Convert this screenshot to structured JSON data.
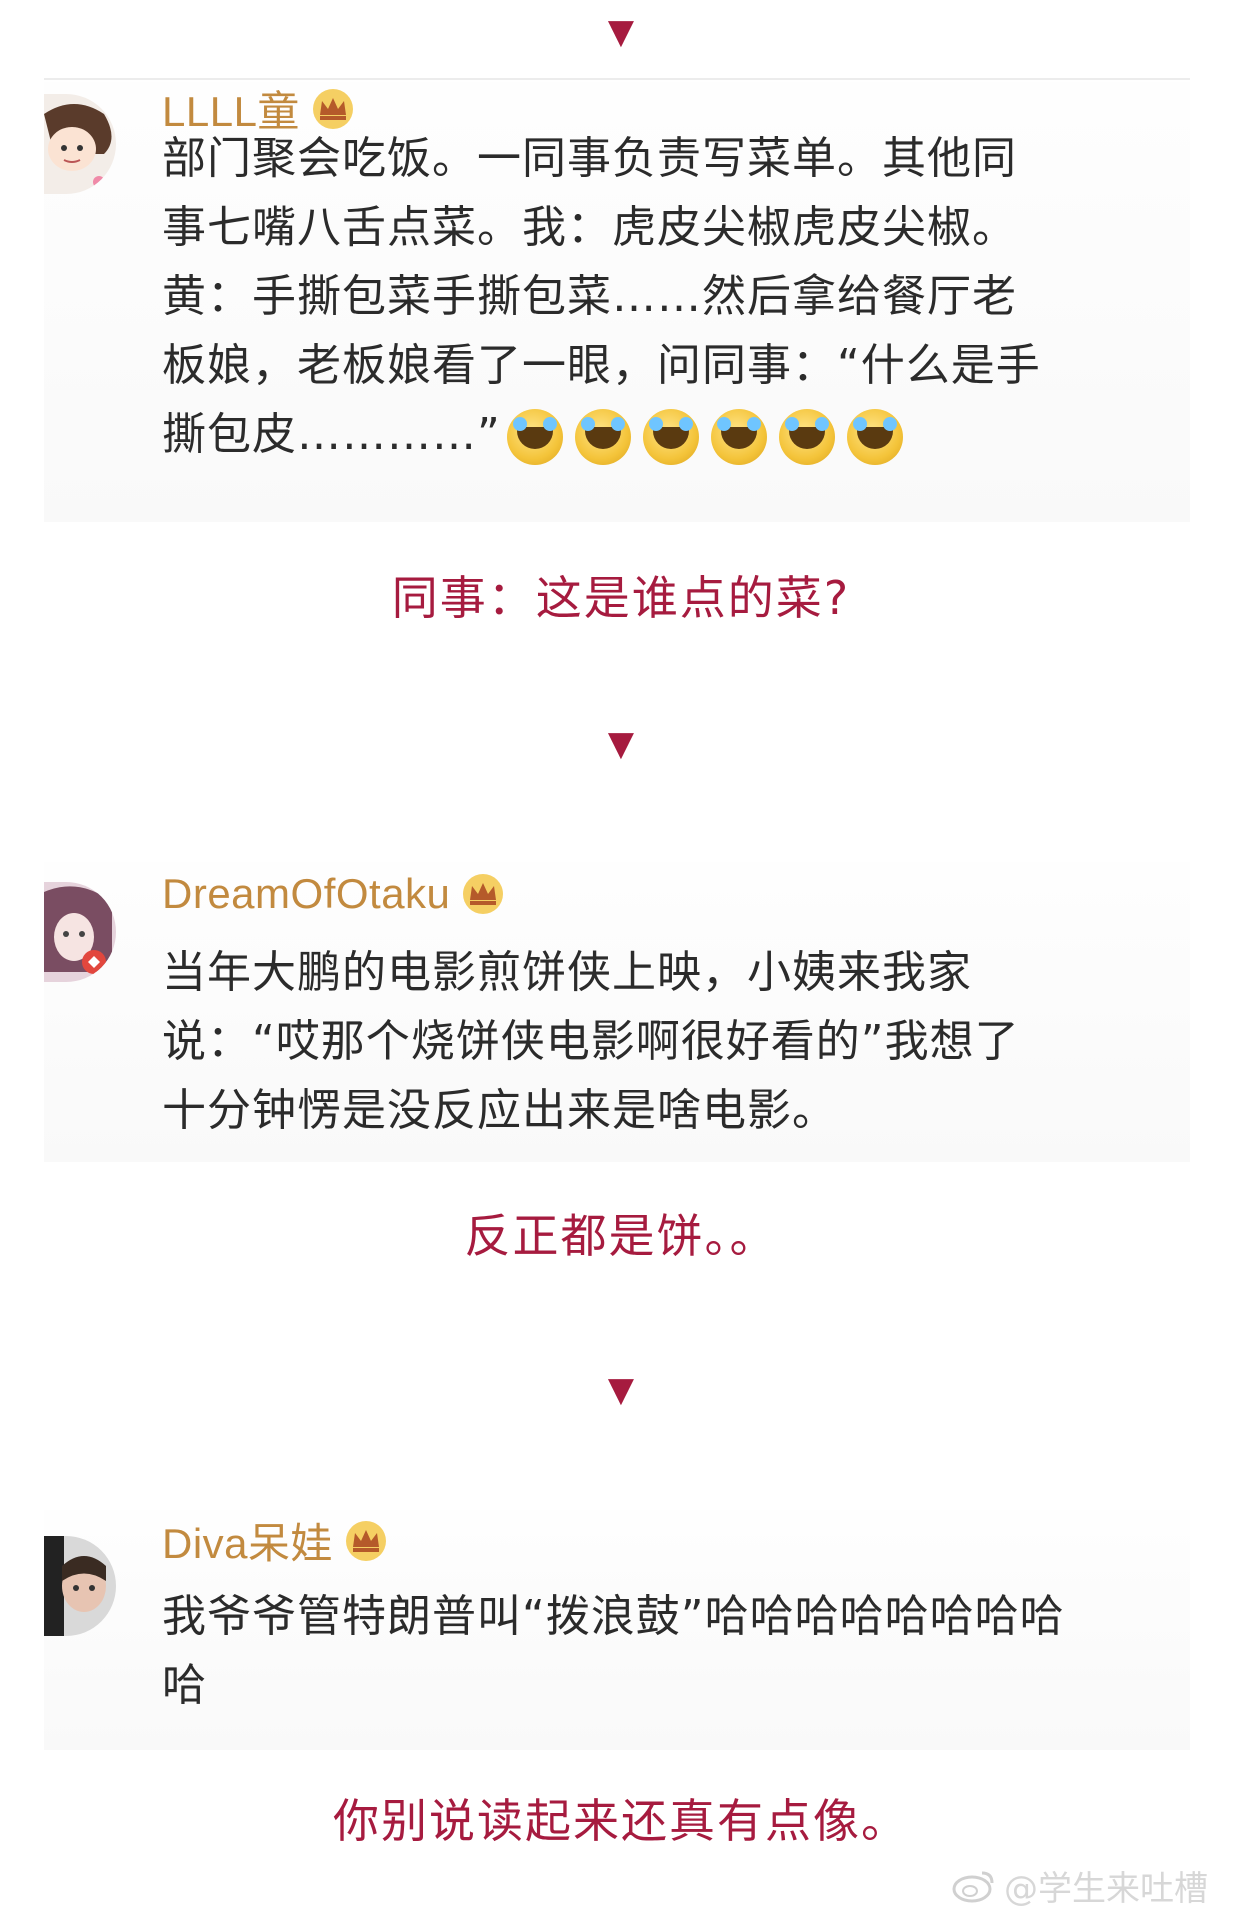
{
  "marker_glyph": "▼",
  "posts": [
    {
      "username": "LLLL童",
      "text": "部门聚会吃饭。一同事负责写菜单。其他同\n事七嘴八舌点菜。我：虎皮尖椒虎皮尖椒。\n黄：手撕包菜手撕包菜……然后拿给餐厅老\n板娘，老板娘看了一眼，问同事：“什么是手\n撕包皮…………”",
      "emoji_count": 6,
      "caption": "同事：这是谁点的菜?"
    },
    {
      "username": "DreamOfOtaku",
      "text": "当年大鹏的电影煎饼侠上映，小姨来我家\n说：“哎那个烧饼侠电影啊很好看的”我想了\n十分钟愣是没反应出来是啥电影。",
      "caption": "反正都是饼。。"
    },
    {
      "username": "Diva呆娃",
      "text": "我爷爷管特朗普叫“拨浪鼓”哈哈哈哈哈哈哈哈\n哈",
      "caption": "你别说读起来还真有点像。"
    }
  ],
  "watermark": "@学生来吐槽",
  "colors": {
    "accent": "#a61b3f",
    "username": "#c28a3f",
    "body_text": "#2b2b2b",
    "watermark": "#d7d7d7"
  }
}
